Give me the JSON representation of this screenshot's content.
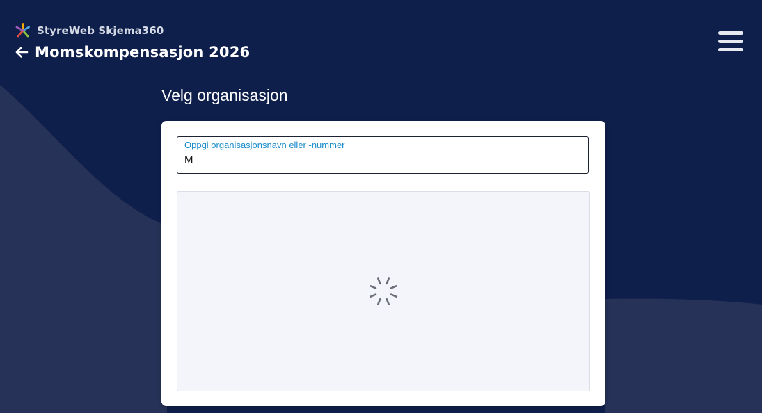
{
  "header": {
    "brand_name": "StyreWeb Skjema360",
    "page_title": "Momskompensasjon 2026"
  },
  "main": {
    "heading": "Velg organisasjon",
    "search": {
      "label": "Oppgi organisasjonsnavn eller -nummer",
      "value": "M"
    }
  },
  "colors": {
    "background": "#0f1f4b",
    "accent_label": "#1a8ccc",
    "results_panel": "#f3f5fa"
  },
  "icons": {
    "brand": "skjema360-logo-icon",
    "back": "arrow-left-icon",
    "menu": "hamburger-menu-icon",
    "loading": "loading-spinner-icon"
  }
}
